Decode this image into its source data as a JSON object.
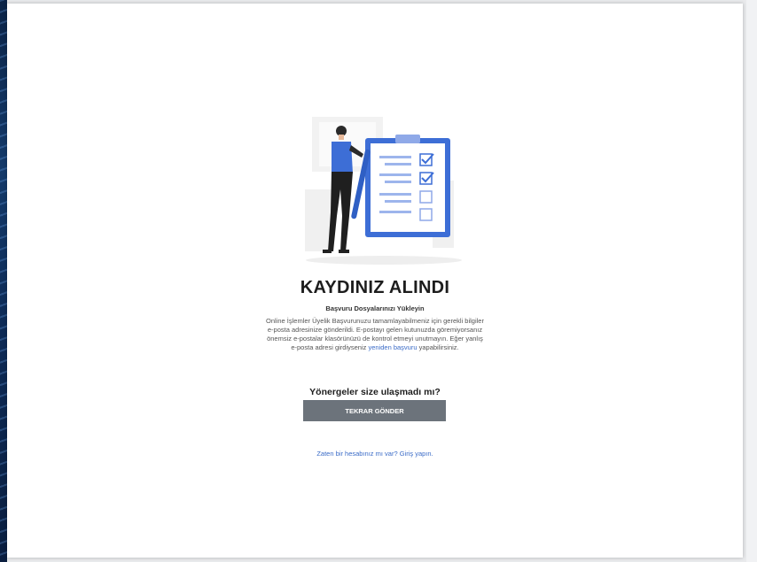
{
  "page": {
    "title": "KAYDINIZ ALINDI",
    "subtitle": "Başvuru Dosyalarınızı Yükleyin",
    "description_part1": "Online İşlemler Üyelik Başvurunuzu tamamlayabilmeniz için gerekli bilgiler e-posta adresinize gönderildi. E-postayı gelen kutunuzda göremiyorsanız önemsiz e-postalar klasörünüzü de kontrol etmeyi unutmayın. Eğer yanlış e-posta adresi girdiyseniz",
    "description_link": "yeniden başvuru",
    "description_part2": "yapabilirsiniz.",
    "question": "Yönergeler size ulaşmadı mı?",
    "resend_button": "TEKRAR GÖNDER",
    "login_link": "Zaten bir hesabınız mı var? Giriş yapın."
  },
  "colors": {
    "button": "#6c737b",
    "link": "#3a6bc7",
    "accent_blue": "#3d6ed6"
  },
  "icons": {
    "illustration": "checklist-person-illustration"
  }
}
